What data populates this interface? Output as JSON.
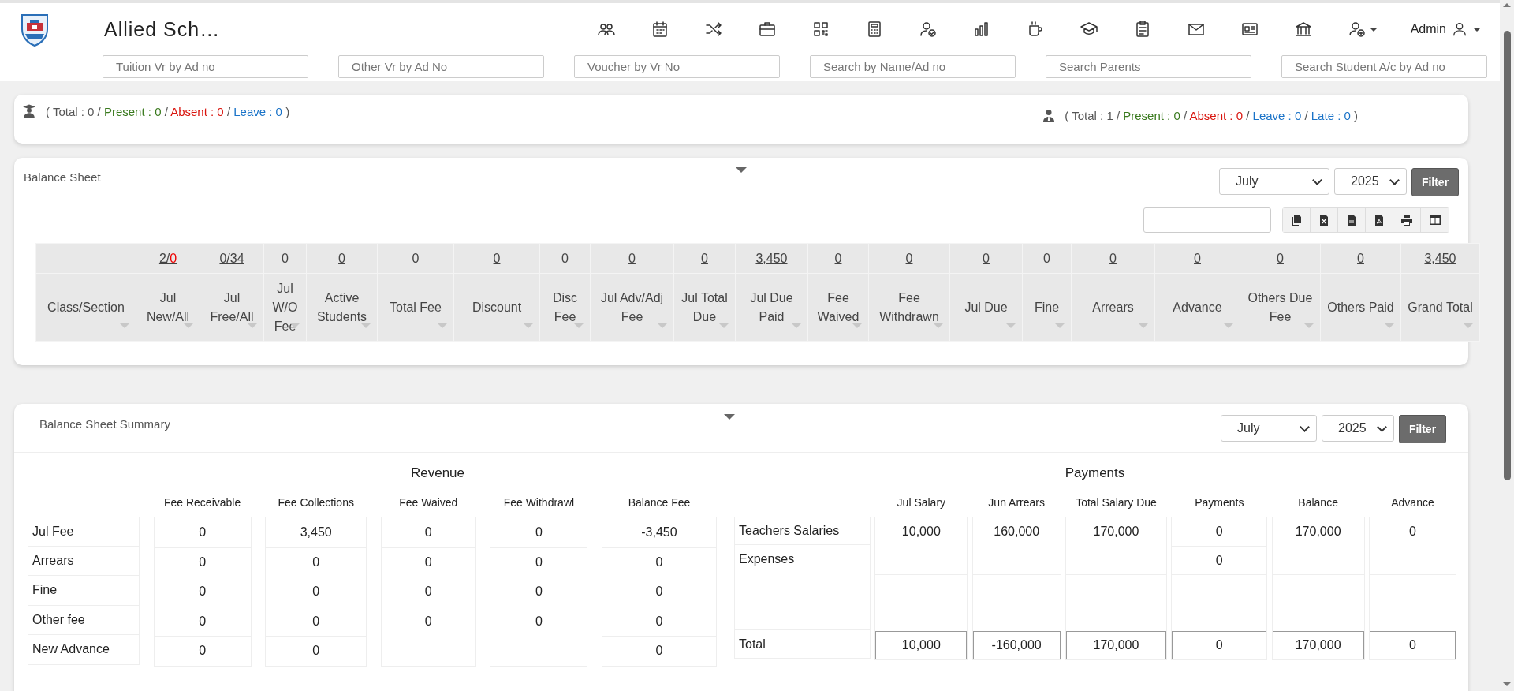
{
  "header": {
    "school_name": "Allied Sch…",
    "user": "Admin",
    "searches": [
      {
        "placeholder": "Tuition Vr by Ad no"
      },
      {
        "placeholder": "Other Vr by Ad No"
      },
      {
        "placeholder": "Voucher by Vr No"
      },
      {
        "placeholder": "Search by Name/Ad no"
      },
      {
        "placeholder": "Search Parents"
      },
      {
        "placeholder": "Search Student A/c by Ad no"
      }
    ]
  },
  "attendance": {
    "students": [
      {
        "text": "( Total : 0 /",
        "color": "#555555"
      },
      {
        "text": "Present : 0",
        "color": "#3a7a1e"
      },
      {
        "text": "/",
        "color": "#555555"
      },
      {
        "text": "Absent : 0",
        "color": "#d9150e"
      },
      {
        "text": "/",
        "color": "#555555"
      },
      {
        "text": "Leave : 0",
        "color": "#1a73c8"
      },
      {
        "text": ")",
        "color": "#555555"
      }
    ],
    "staff": [
      {
        "text": "( Total : 1 /",
        "color": "#555555"
      },
      {
        "text": "Present : 0",
        "color": "#3a7a1e"
      },
      {
        "text": "/",
        "color": "#555555"
      },
      {
        "text": "Absent : 0",
        "color": "#d9150e"
      },
      {
        "text": "/",
        "color": "#555555"
      },
      {
        "text": "Leave : 0",
        "color": "#1a73c8"
      },
      {
        "text": "/",
        "color": "#555555"
      },
      {
        "text": "Late : 0",
        "color": "#1a73c8"
      },
      {
        "text": ")",
        "color": "#555555"
      }
    ]
  },
  "balance_sheet": {
    "title": "Balance Sheet",
    "month": "July",
    "year": "2025",
    "filter": "Filter",
    "columns": [
      {
        "label": "Class/Section"
      },
      {
        "label": "Jul New/All",
        "total": "2/",
        "total_alert": "0",
        "link": true
      },
      {
        "label": "Jul Free/All",
        "total": "0/34",
        "link": true
      },
      {
        "label": "Jul W/O Fee",
        "total": "0",
        "link": false
      },
      {
        "label": "Active Students",
        "total": "0",
        "link": true
      },
      {
        "label": "Total Fee",
        "total": "0",
        "link": false
      },
      {
        "label": "Discount",
        "total": "0",
        "link": true
      },
      {
        "label": "Disc Fee",
        "total": "0",
        "link": false
      },
      {
        "label": "Jul Adv/Adj Fee",
        "total": "0",
        "link": true
      },
      {
        "label": "Jul Total Due",
        "total": "0",
        "link": true
      },
      {
        "label": "Jul Due Paid",
        "total": "3,450",
        "link": true
      },
      {
        "label": "Fee Waived",
        "total": "0",
        "link": true
      },
      {
        "label": "Fee Withdrawn",
        "total": "0",
        "link": true
      },
      {
        "label": "Jul Due",
        "total": "0",
        "link": true
      },
      {
        "label": "Fine",
        "total": "0",
        "link": false
      },
      {
        "label": "Arrears",
        "total": "0",
        "link": true
      },
      {
        "label": "Advance",
        "total": "0",
        "link": true
      },
      {
        "label": "Others Due Fee",
        "total": "0",
        "link": true
      },
      {
        "label": "Others Paid",
        "total": "0",
        "link": true
      },
      {
        "label": "Grand Total",
        "total": "3,450",
        "link": true
      }
    ]
  },
  "summary": {
    "title": "Balance Sheet Summary",
    "month": "July",
    "year": "2025",
    "filter": "Filter",
    "revenue": {
      "title": "Revenue",
      "columns": [
        "Fee Receivable",
        "Fee Collections",
        "Fee Waived",
        "Fee Withdrawl",
        "Balance Fee"
      ],
      "rows": [
        {
          "label": "Jul Fee",
          "cells": [
            "0",
            "3,450",
            "0",
            "0",
            "-3,450"
          ]
        },
        {
          "label": "Arrears",
          "cells": [
            "0",
            "0",
            "0",
            "0",
            "0"
          ]
        },
        {
          "label": "Fine",
          "cells": [
            "0",
            "0",
            "0",
            "0",
            "0"
          ]
        },
        {
          "label": "Other fee",
          "cells": [
            "0",
            "0",
            "0",
            "0",
            "0"
          ]
        },
        {
          "label": "New Advance",
          "cells": [
            "0",
            "0",
            null,
            null,
            "0"
          ]
        }
      ]
    },
    "payments": {
      "title": "Payments",
      "columns": [
        "Jul Salary",
        "Jun Arrears",
        "Total Salary Due",
        "Payments",
        "Balance",
        "Advance"
      ],
      "rows": [
        {
          "kind": "item",
          "label": "Teachers Salaries",
          "cells": [
            "10,000",
            "160,000",
            "170,000",
            "0",
            "170,000",
            "0"
          ]
        },
        {
          "kind": "item",
          "label": "Expenses",
          "cells": [
            null,
            null,
            null,
            "0",
            null,
            null
          ]
        },
        {
          "kind": "spacer"
        },
        {
          "kind": "total",
          "label": "Total",
          "cells": [
            "10,000",
            "-160,000",
            "170,000",
            "0",
            "170,000",
            "0"
          ]
        }
      ]
    }
  }
}
